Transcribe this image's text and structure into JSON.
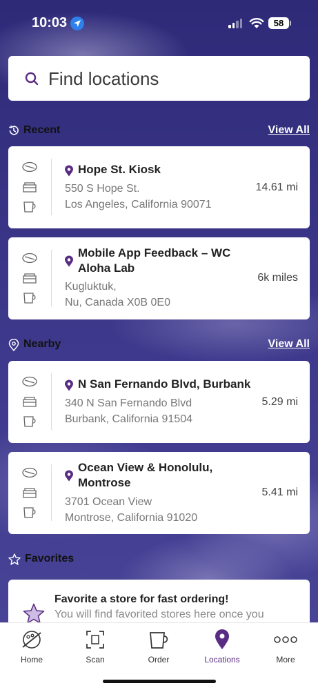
{
  "status_bar": {
    "time": "10:03",
    "battery": "58"
  },
  "search": {
    "placeholder": "Find locations"
  },
  "sections": {
    "recent": {
      "title": "Recent",
      "view_all": "View All"
    },
    "nearby": {
      "title": "Nearby",
      "view_all": "View All"
    },
    "favorites": {
      "title": "Favorites"
    }
  },
  "recent": [
    {
      "name": "Hope St. Kiosk",
      "address_line1": "550 S Hope St.",
      "address_line2": "Los Angeles, California 90071",
      "distance": "14.61 mi"
    },
    {
      "name": "Mobile App Feedback – WC Aloha Lab",
      "address_line1": "Kugluktuk,",
      "address_line2": "Nu, Canada X0B 0E0",
      "distance": "6k miles"
    }
  ],
  "nearby": [
    {
      "name": "N San Fernando Blvd, Burbank",
      "address_line1": "340 N San Fernando Blvd",
      "address_line2": "Burbank, California 91504",
      "distance": "5.29 mi"
    },
    {
      "name": "Ocean View & Honolulu, Montrose",
      "address_line1": "3701 Ocean View",
      "address_line2": "Montrose, California 91020",
      "distance": "5.41 mi"
    }
  ],
  "favorites_empty": {
    "title": "Favorite a store for fast ordering!",
    "subtitle": "You will find favorited stores here once you"
  },
  "tabs": [
    {
      "label": "Home",
      "icon": "home-icon"
    },
    {
      "label": "Scan",
      "icon": "scan-icon"
    },
    {
      "label": "Order",
      "icon": "cup-icon"
    },
    {
      "label": "Locations",
      "icon": "location-pin-icon",
      "active": true
    },
    {
      "label": "More",
      "icon": "more-dots-icon"
    }
  ],
  "colors": {
    "accent": "#5a2d84",
    "background": "#3a3586"
  }
}
